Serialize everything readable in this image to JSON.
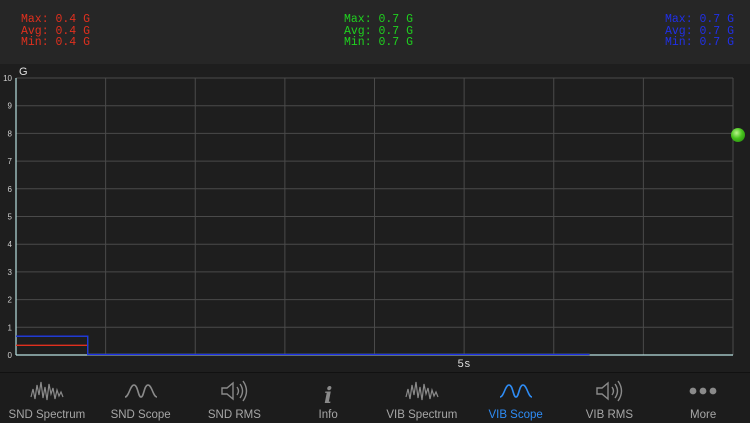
{
  "stats": {
    "x": {
      "color": "#e0301e",
      "max": "Max: 0.4 G",
      "avg": "Avg: 0.4 G",
      "min": "Min: 0.4 G"
    },
    "y": {
      "color": "#1fd11f",
      "max": "Max: 0.7 G",
      "avg": "Avg: 0.7 G",
      "min": "Min: 0.7 G"
    },
    "z": {
      "color": "#2030e8",
      "max": "Max: 0.7 G",
      "avg": "Avg: 0.7 G",
      "min": "Min: 0.7 G"
    }
  },
  "chart_data": {
    "type": "line",
    "ylabel": "G",
    "ylim": [
      0,
      10
    ],
    "yticks": [
      "0",
      "1",
      "2",
      "3",
      "4",
      "5",
      "6",
      "7",
      "8",
      "9",
      "10"
    ],
    "xlabel": "5s",
    "grid": true,
    "series": [
      {
        "color": "#e0301e",
        "x": [
          0.0,
          0.1,
          0.1,
          0.8
        ],
        "y": [
          0.35,
          0.35,
          0.02,
          0.02
        ]
      },
      {
        "color": "#1fd11f",
        "x": [
          0.0,
          0.1,
          0.1,
          0.8
        ],
        "y": [
          0.68,
          0.68,
          0.02,
          0.02
        ]
      },
      {
        "color": "#2030e8",
        "x": [
          0.0,
          0.1,
          0.1,
          0.8
        ],
        "y": [
          0.68,
          0.68,
          0.02,
          0.02
        ]
      }
    ]
  },
  "colors": {
    "accent": "#2e8cf5",
    "tab_inactive": "#a6a6a6",
    "grid": "#4a4a4a",
    "axis": "#b8e0e0",
    "status": "#46c21c"
  },
  "tabs": [
    {
      "label": "SND Spectrum",
      "icon": "spectrum-icon"
    },
    {
      "label": "SND Scope",
      "icon": "wave-icon"
    },
    {
      "label": "SND RMS",
      "icon": "speaker-icon"
    },
    {
      "label": "Info",
      "icon": "info-icon",
      "glyph": "i"
    },
    {
      "label": "VIB Spectrum",
      "icon": "spectrum-icon"
    },
    {
      "label": "VIB Scope",
      "icon": "wave-icon",
      "active": true
    },
    {
      "label": "VIB RMS",
      "icon": "speaker-icon"
    },
    {
      "label": "More",
      "icon": "more-icon"
    }
  ]
}
